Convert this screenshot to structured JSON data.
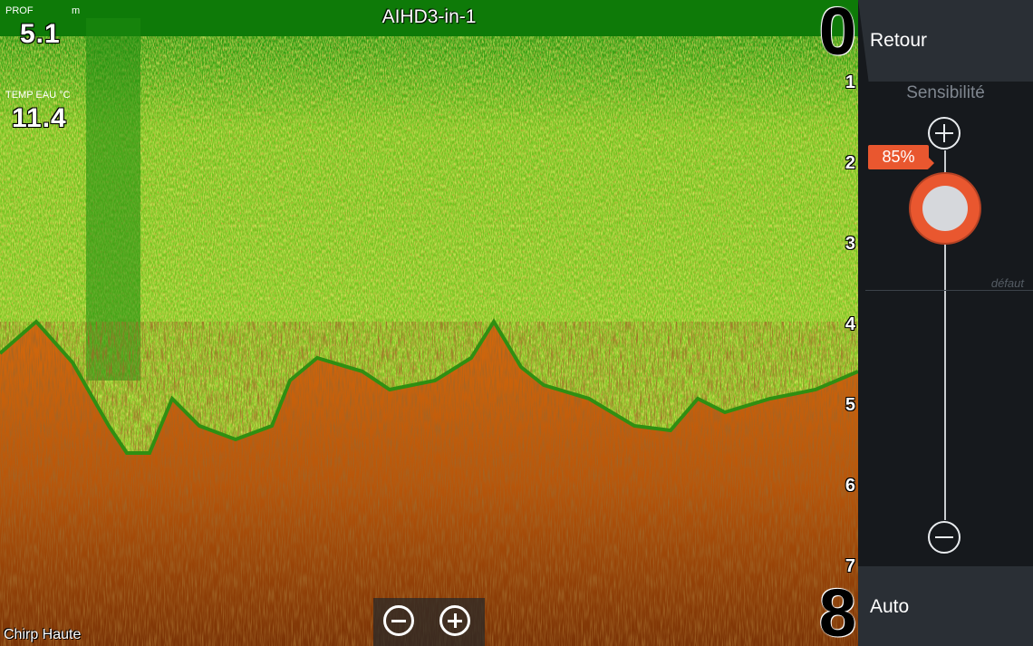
{
  "sonar": {
    "title": "AIHD3-in-1",
    "depth_label": "PROF",
    "depth_unit": "m",
    "depth_value": "5.1",
    "temp_label": "TEMP EAU °C",
    "temp_value": "11.4",
    "mode": "Chirp Haute",
    "scale_top": "0",
    "scale_bottom": "8",
    "scale_ticks": [
      "1",
      "2",
      "3",
      "4",
      "5",
      "6",
      "7"
    ]
  },
  "panel": {
    "back_label": "Retour",
    "sensitivity_title": "Sensibilité",
    "sensitivity_percent": 85,
    "sensitivity_text": "85%",
    "default_label": "défaut",
    "auto_label": "Auto"
  },
  "colors": {
    "surface_green": "#1f7a0c",
    "echo_yellow": "#c9e23a",
    "bottom_orange": "#c8620a",
    "accent": "#e9572f",
    "panel_bg": "#16191d"
  },
  "icons": {
    "zoom_out": "minus-circle-icon",
    "zoom_in": "plus-circle-icon",
    "sens_up": "plus-circle-icon",
    "sens_down": "minus-circle-icon"
  }
}
